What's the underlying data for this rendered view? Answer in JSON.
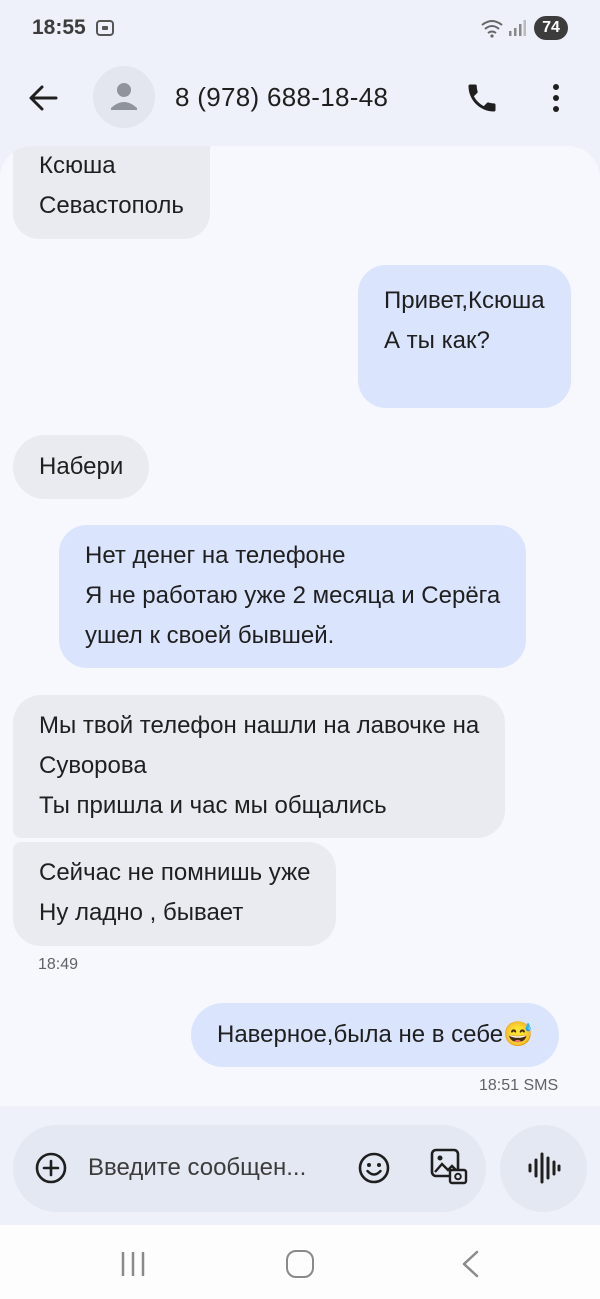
{
  "status": {
    "time": "18:55",
    "battery": "74",
    "icons": [
      "screen-record-icon",
      "wifi-icon",
      "signal-icon"
    ]
  },
  "header": {
    "contact": "8 (978) 688-18-48",
    "icons": [
      "back-arrow-icon",
      "avatar-icon",
      "phone-icon",
      "more-vert-icon"
    ]
  },
  "messages": [
    {
      "dir": "in",
      "text": "Ксюша\nСевастополь"
    },
    {
      "dir": "out",
      "text": "Привет,Ксюша\nА ты как?"
    },
    {
      "dir": "in",
      "text": "Набери"
    },
    {
      "dir": "out",
      "text": "Нет денег на телефоне\nЯ не работаю уже 2 месяца и Серёга\nушел к своей бывшей."
    },
    {
      "dir": "in",
      "text": "Мы твой телефон нашли на лавочке на\nСуворова\nТы пришла и час мы общались"
    },
    {
      "dir": "in",
      "text": "Сейчас не помнишь уже\nНу ладно , бывает"
    },
    {
      "dir": "out",
      "text": "Наверное,была не в себе😅"
    }
  ],
  "timestamps": {
    "in_group": "18:49",
    "last_out": "18:51 SMS"
  },
  "composer": {
    "placeholder": "Введите сообщен...",
    "icons": [
      "add-circle-icon",
      "emoji-icon",
      "gallery-icon",
      "voice-wave-icon"
    ]
  },
  "nav": {
    "icons": [
      "recent-apps-icon",
      "home-icon",
      "back-icon"
    ]
  },
  "colors": {
    "incoming_bubble": "#e9ebf1",
    "outgoing_bubble": "#dbe4fd",
    "background": "#f6f8fd"
  }
}
